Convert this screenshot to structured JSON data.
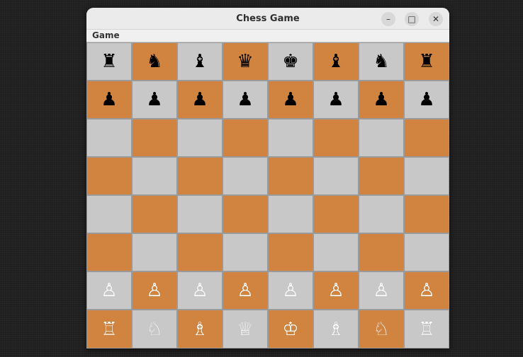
{
  "window": {
    "title": "Chess Game",
    "controls": {
      "minimize": "–",
      "maximize": "□",
      "close": "✕"
    }
  },
  "menu": {
    "items": [
      "Game"
    ]
  },
  "colors": {
    "light_square": "#c8c8c8",
    "dark_square": "#d0843f",
    "black_piece": "#000000",
    "white_piece": "#ffffff"
  },
  "board": {
    "rows": [
      [
        "♜",
        "♞",
        "♝",
        "♛",
        "♚",
        "♝",
        "♞",
        "♜"
      ],
      [
        "♟",
        "♟",
        "♟",
        "♟",
        "♟",
        "♟",
        "♟",
        "♟"
      ],
      [
        "",
        "",
        "",
        "",
        "",
        "",
        "",
        ""
      ],
      [
        "",
        "",
        "",
        "",
        "",
        "",
        "",
        ""
      ],
      [
        "",
        "",
        "",
        "",
        "",
        "",
        "",
        ""
      ],
      [
        "",
        "",
        "",
        "",
        "",
        "",
        "",
        ""
      ],
      [
        "♙",
        "♙",
        "♙",
        "♙",
        "♙",
        "♙",
        "♙",
        "♙"
      ],
      [
        "♖",
        "♘",
        "♗",
        "♕",
        "♔",
        "♗",
        "♘",
        "♖"
      ]
    ],
    "piece_names": [
      [
        "black-rook",
        "black-knight",
        "black-bishop",
        "black-queen",
        "black-king",
        "black-bishop",
        "black-knight",
        "black-rook"
      ],
      [
        "black-pawn",
        "black-pawn",
        "black-pawn",
        "black-pawn",
        "black-pawn",
        "black-pawn",
        "black-pawn",
        "black-pawn"
      ],
      [
        "",
        "",
        "",
        "",
        "",
        "",
        "",
        ""
      ],
      [
        "",
        "",
        "",
        "",
        "",
        "",
        "",
        ""
      ],
      [
        "",
        "",
        "",
        "",
        "",
        "",
        "",
        ""
      ],
      [
        "",
        "",
        "",
        "",
        "",
        "",
        "",
        ""
      ],
      [
        "white-pawn",
        "white-pawn",
        "white-pawn",
        "white-pawn",
        "white-pawn",
        "white-pawn",
        "white-pawn",
        "white-pawn"
      ],
      [
        "white-rook",
        "white-knight",
        "white-bishop",
        "white-queen",
        "white-king",
        "white-bishop",
        "white-knight",
        "white-rook"
      ]
    ]
  }
}
